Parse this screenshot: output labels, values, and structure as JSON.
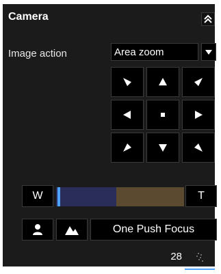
{
  "panel": {
    "title": "Camera",
    "collapse_icon": "double-chevron-up-icon"
  },
  "image_action": {
    "label": "Image action",
    "selected_value": "Area zoom",
    "dropdown_icon": "triangle-down-icon"
  },
  "ptz": {
    "buttons": [
      {
        "name": "ptz-up-left",
        "icon": "arrow-up-left-icon"
      },
      {
        "name": "ptz-up",
        "icon": "arrow-up-icon"
      },
      {
        "name": "ptz-up-right",
        "icon": "arrow-up-right-icon"
      },
      {
        "name": "ptz-left",
        "icon": "arrow-left-icon"
      },
      {
        "name": "ptz-home",
        "icon": "home-square-icon"
      },
      {
        "name": "ptz-right",
        "icon": "arrow-right-icon"
      },
      {
        "name": "ptz-down-left",
        "icon": "arrow-down-left-icon"
      },
      {
        "name": "ptz-down",
        "icon": "arrow-down-icon"
      },
      {
        "name": "ptz-down-right",
        "icon": "arrow-down-right-icon"
      }
    ]
  },
  "zoom": {
    "wide_label": "W",
    "tele_label": "T",
    "position_fraction": 0.0
  },
  "focus": {
    "near_icon": "person-icon",
    "far_icon": "mountain-icon",
    "one_push_label": "One Push Focus"
  },
  "footer": {
    "zoom_value": "28",
    "zoom_icon": "zoom-indicator-icon"
  },
  "colors": {
    "panel_bg": "#1b1b1b",
    "accent": "#4da3ff",
    "zoom_bar_wide": "#2a2d5a",
    "zoom_bar_tele": "#5b4a2f"
  }
}
